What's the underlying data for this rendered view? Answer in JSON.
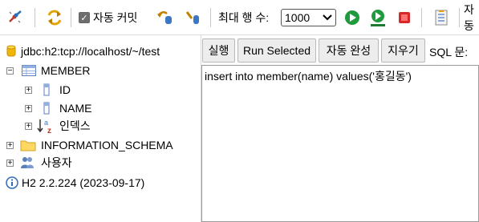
{
  "toolbar": {
    "autocommit_label": "자동 커밋",
    "autocommit_checked": true,
    "max_rows_label": "최대 행 수:",
    "max_rows_value": "1000",
    "trailing_label": "자동"
  },
  "tree": {
    "connection": "jdbc:h2:tcp://localhost/~/test",
    "table": "MEMBER",
    "columns": [
      "ID",
      "NAME"
    ],
    "indexes": "인덱스",
    "schema": "INFORMATION_SCHEMA",
    "users": "사용자",
    "version": "H2 2.2.224 (2023-09-17)"
  },
  "actions": {
    "run": "실행",
    "run_selected": "Run Selected",
    "autocomplete": "자동 완성",
    "clear": "지우기",
    "sql_label": "SQL 문:"
  },
  "editor": {
    "sql": "insert into member(name) values('홍길동')"
  }
}
